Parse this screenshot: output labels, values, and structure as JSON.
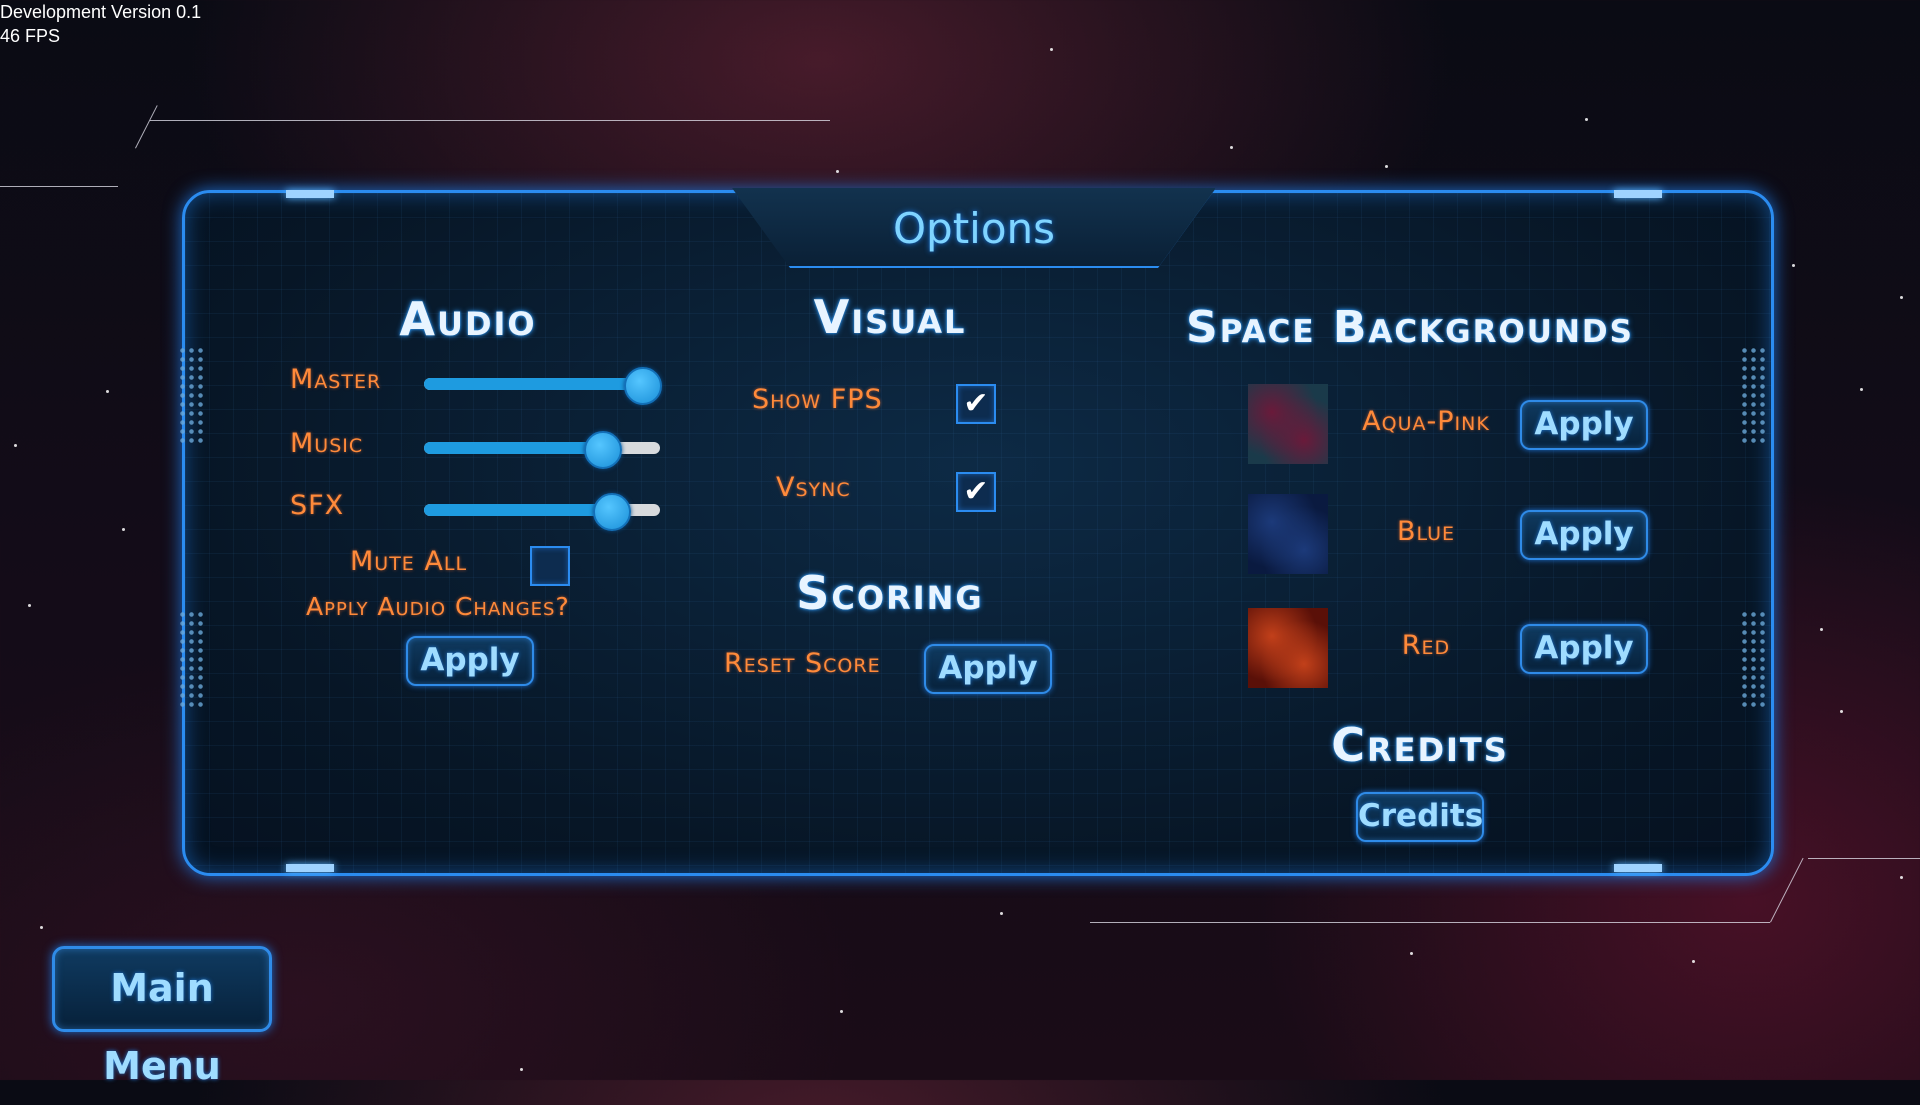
{
  "debug": {
    "version": "Development Version 0.1",
    "fps": "46 FPS"
  },
  "title": "Options",
  "audio": {
    "heading": "Audio",
    "master": {
      "label": "Master",
      "value": 0.92
    },
    "music": {
      "label": "Music",
      "value": 0.75
    },
    "sfx": {
      "label": "SFX",
      "value": 0.79
    },
    "mute_all": {
      "label": "Mute All",
      "checked": false
    },
    "apply_prompt": "Apply Audio Changes?",
    "apply_button": "Apply"
  },
  "visual": {
    "heading": "Visual",
    "show_fps": {
      "label": "Show FPS",
      "checked": true
    },
    "vsync": {
      "label": "Vsync",
      "checked": true
    }
  },
  "scoring": {
    "heading": "Scoring",
    "reset_label": "Reset Score",
    "apply_button": "Apply"
  },
  "backgrounds": {
    "heading": "Space Backgrounds",
    "items": [
      {
        "name": "Aqua-Pink",
        "button": "Apply",
        "colors": [
          "#1a3a4a",
          "#6a1a3a"
        ]
      },
      {
        "name": "Blue",
        "button": "Apply",
        "colors": [
          "#0a1a40",
          "#1c3a7a"
        ]
      },
      {
        "name": "Red",
        "button": "Apply",
        "colors": [
          "#5a1008",
          "#c2401a"
        ]
      }
    ]
  },
  "credits": {
    "heading": "Credits",
    "button": "Credits"
  },
  "main_menu_button": "Main Menu",
  "colors": {
    "accent": "#2b8cf0",
    "label": "#ff8a3a",
    "button_text": "#9fdcff"
  }
}
